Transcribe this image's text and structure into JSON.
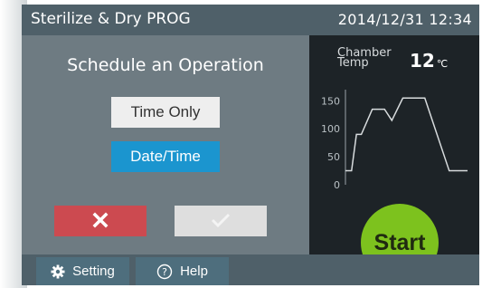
{
  "header": {
    "title": "Sterilize & Dry PROG",
    "datetime": "2014/12/31  12:34"
  },
  "schedule": {
    "heading": "Schedule an Operation",
    "time_only_label": "Time Only",
    "date_time_label": "Date/Time",
    "selected": "Date/Time",
    "cancel_icon": "close-icon",
    "confirm_icon": "check-icon",
    "confirm_enabled": false
  },
  "chamber": {
    "label_line1": "Chamber",
    "label_line2": "Temp",
    "value": "12",
    "unit": "℃"
  },
  "chart_data": {
    "type": "line",
    "yticks": [
      0,
      50,
      100,
      150
    ],
    "ylim": [
      0,
      170
    ],
    "xlim": [
      0,
      100
    ],
    "x": [
      0,
      5,
      9,
      13,
      22,
      32,
      38,
      47,
      65,
      85,
      90,
      100
    ],
    "y": [
      25,
      25,
      90,
      90,
      135,
      135,
      115,
      155,
      155,
      25,
      25,
      25
    ],
    "xlabel": "",
    "ylabel": ""
  },
  "start_label": "Start",
  "footer": {
    "setting_label": "Setting",
    "help_label": "Help"
  },
  "colors": {
    "titlebar": "#4f6069",
    "panel": "#6e7b82",
    "selected": "#1b95cf",
    "cancel": "#cc4a50",
    "start": "#7dc21e",
    "chart_bg": "#1d2327"
  }
}
